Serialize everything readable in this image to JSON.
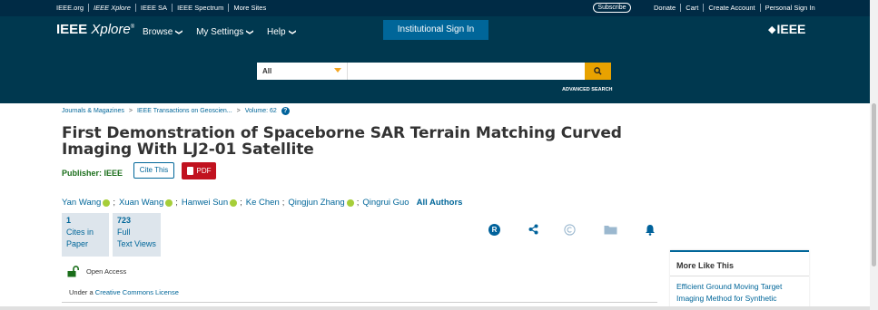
{
  "topbar": {
    "links": [
      "IEEE.org",
      "IEEE Xplore",
      "IEEE SA",
      "IEEE Spectrum",
      "More Sites"
    ],
    "subscribe": "Subscribe",
    "right_links": [
      "Donate",
      "Cart",
      "Create Account",
      "Personal Sign In"
    ]
  },
  "header": {
    "logo_main": "IEEE",
    "logo_italic": "Xplore",
    "nav": [
      "Browse",
      "My Settings",
      "Help"
    ],
    "signin": "Institutional Sign In",
    "brand": "IEEE"
  },
  "search": {
    "scope": "All",
    "placeholder": "",
    "advanced": "ADVANCED SEARCH"
  },
  "breadcrumb": [
    "Journals & Magazines",
    "IEEE Transactions on Geoscien...",
    "Volume: 62"
  ],
  "article": {
    "title": "First Demonstration of Spaceborne SAR Terrain Matching Curved Imaging With LJ2-01 Satellite",
    "publisher_label": "Publisher: IEEE",
    "cite_button": "Cite This",
    "pdf_button": "PDF",
    "authors": [
      {
        "name": "Yan Wang",
        "orcid": true
      },
      {
        "name": "Xuan Wang",
        "orcid": true
      },
      {
        "name": "Hanwei Sun",
        "orcid": true
      },
      {
        "name": "Ke Chen",
        "orcid": false
      },
      {
        "name": "Qingjun Zhang",
        "orcid": true
      },
      {
        "name": "Qingrui Guo",
        "orcid": false
      }
    ],
    "all_authors": "All Authors",
    "metrics": [
      {
        "number": "1",
        "line1": "Cites in",
        "line2": "Paper"
      },
      {
        "number": "723",
        "line1": "Full",
        "line2": "Text Views"
      }
    ],
    "open_access": "Open Access",
    "license_prefix": "Under a ",
    "license_link": "Creative Commons License"
  },
  "sidebar": {
    "more_like_title": "More Like This",
    "items": [
      "Efficient Ground Moving Target Imaging Method for Synthetic"
    ]
  },
  "colors": {
    "topbar": "#002b45",
    "header": "#00384f",
    "link": "#006699",
    "search_button": "#e8a200",
    "pdf": "#c1121f",
    "publisher": "#1a6e1a"
  }
}
